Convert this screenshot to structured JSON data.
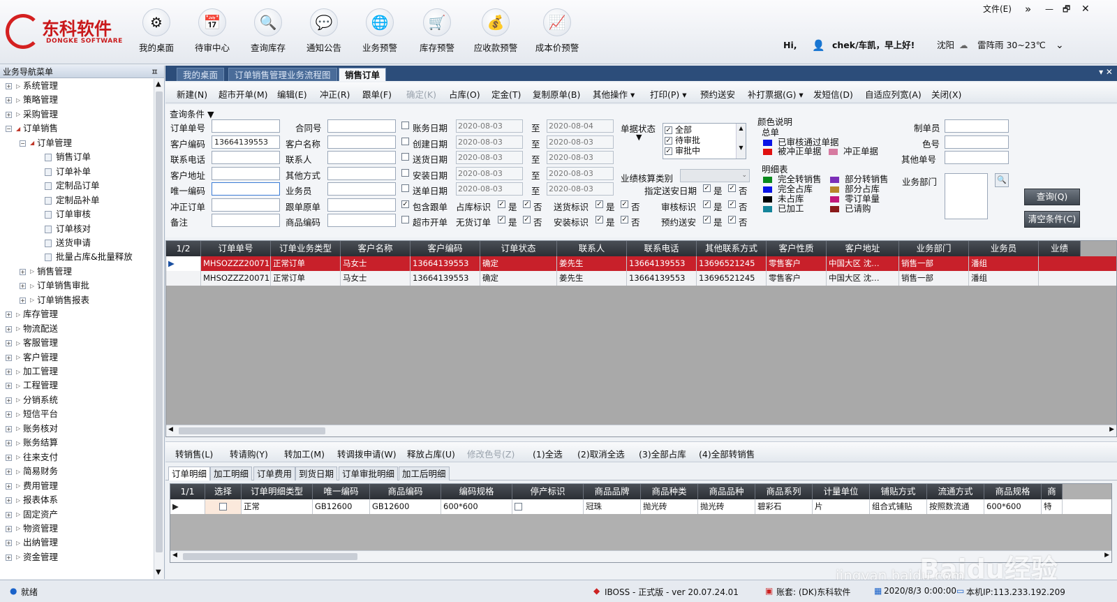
{
  "app": {
    "logo_cn": "东科软件",
    "logo_en": "DONGKE SOFTWARE"
  },
  "toolbar": [
    {
      "label": "我的桌面",
      "icon": "gear-network-icon",
      "glyph": "⚙"
    },
    {
      "label": "待审中心",
      "icon": "calendar-edit-icon",
      "glyph": "📅"
    },
    {
      "label": "查询库存",
      "icon": "magnifier-icon",
      "glyph": "🔍"
    },
    {
      "label": "通知公告",
      "icon": "chat-people-icon",
      "glyph": "💬"
    },
    {
      "label": "业务预警",
      "icon": "globe-icon",
      "glyph": "🌐"
    },
    {
      "label": "库存预警",
      "icon": "cart-window-icon",
      "glyph": "🛒"
    },
    {
      "label": "应收款预警",
      "icon": "money-person-icon",
      "glyph": "💰"
    },
    {
      "label": "成本价预警",
      "icon": "runner-arrow-icon",
      "glyph": "📈"
    }
  ],
  "window": {
    "menu": "文件(E)",
    "more": "»",
    "min": "—",
    "restore": "🗗",
    "close": "✕"
  },
  "user": {
    "hi": "Hi,",
    "greeting": "chek/车凯，早上好!",
    "city": "沈阳",
    "weather": "雷阵雨 30~23℃"
  },
  "sidebar": {
    "title": "业务导航菜单",
    "pin": "ㅍ",
    "items": [
      {
        "label": "系统管理",
        "level": 0,
        "exp": "+"
      },
      {
        "label": "策略管理",
        "level": 0,
        "exp": "+"
      },
      {
        "label": "采购管理",
        "level": 0,
        "exp": "+"
      },
      {
        "label": "订单销售",
        "level": 0,
        "exp": "-"
      },
      {
        "label": "订单管理",
        "level": 1,
        "exp": "-"
      },
      {
        "label": "销售订单",
        "level": 2
      },
      {
        "label": "订单补单",
        "level": 2
      },
      {
        "label": "定制品订单",
        "level": 2
      },
      {
        "label": "定制品补单",
        "level": 2
      },
      {
        "label": "订单审核",
        "level": 2
      },
      {
        "label": "订单核对",
        "level": 2
      },
      {
        "label": "送货申请",
        "level": 2
      },
      {
        "label": "批量占库&批量释放",
        "level": 2
      },
      {
        "label": "销售管理",
        "level": 1,
        "exp": "+"
      },
      {
        "label": "订单销售审批",
        "level": 1,
        "exp": "+"
      },
      {
        "label": "订单销售报表",
        "level": 1,
        "exp": "+"
      },
      {
        "label": "库存管理",
        "level": 0,
        "exp": "+"
      },
      {
        "label": "物流配送",
        "level": 0,
        "exp": "+"
      },
      {
        "label": "客服管理",
        "level": 0,
        "exp": "+"
      },
      {
        "label": "客户管理",
        "level": 0,
        "exp": "+"
      },
      {
        "label": "加工管理",
        "level": 0,
        "exp": "+"
      },
      {
        "label": "工程管理",
        "level": 0,
        "exp": "+"
      },
      {
        "label": "分销系统",
        "level": 0,
        "exp": "+"
      },
      {
        "label": "短信平台",
        "level": 0,
        "exp": "+"
      },
      {
        "label": "账务核对",
        "level": 0,
        "exp": "+"
      },
      {
        "label": "账务结算",
        "level": 0,
        "exp": "+"
      },
      {
        "label": "往来支付",
        "level": 0,
        "exp": "+"
      },
      {
        "label": "简易财务",
        "level": 0,
        "exp": "+"
      },
      {
        "label": "费用管理",
        "level": 0,
        "exp": "+"
      },
      {
        "label": "报表体系",
        "level": 0,
        "exp": "+"
      },
      {
        "label": "固定资产",
        "level": 0,
        "exp": "+"
      },
      {
        "label": "物资管理",
        "level": 0,
        "exp": "+"
      },
      {
        "label": "出纳管理",
        "level": 0,
        "exp": "+"
      },
      {
        "label": "资金管理",
        "level": 0,
        "exp": "+"
      }
    ]
  },
  "tabs": [
    {
      "label": "我的桌面",
      "active": false
    },
    {
      "label": "订单销售管理业务流程图",
      "active": false
    },
    {
      "label": "销售订单",
      "active": true
    }
  ],
  "tab_ctrl": "▾ ✕",
  "actions": [
    {
      "label": "新建(N)"
    },
    {
      "label": "超市开单(M)"
    },
    {
      "label": "编辑(E)"
    },
    {
      "label": "冲正(R)"
    },
    {
      "label": "跟单(F)"
    },
    {
      "label": "确定(K)",
      "disabled": true
    },
    {
      "label": "占库(O)"
    },
    {
      "label": "定金(T)"
    },
    {
      "label": "复制原单(B)"
    },
    {
      "label": "其他操作 ▾"
    },
    {
      "label": "打印(P) ▾"
    },
    {
      "label": "预约送安"
    },
    {
      "label": "补打票据(G) ▾"
    },
    {
      "label": "发短信(D)"
    },
    {
      "label": "自适应列宽(A)"
    },
    {
      "label": "关闭(X)"
    }
  ],
  "query": {
    "header": "查询条件 ▼",
    "left": [
      {
        "label": "订单单号",
        "value": ""
      },
      {
        "label": "客户编码",
        "value": "13664139553"
      },
      {
        "label": "联系电话",
        "value": ""
      },
      {
        "label": "客户地址",
        "value": ""
      },
      {
        "label": "唯一编码",
        "value": ""
      },
      {
        "label": "冲正订单",
        "value": ""
      },
      {
        "label": "备注",
        "value": ""
      }
    ],
    "mid": [
      {
        "label": "合同号",
        "value": ""
      },
      {
        "label": "客户名称",
        "value": ""
      },
      {
        "label": "联系人",
        "value": ""
      },
      {
        "label": "其他方式",
        "value": ""
      },
      {
        "label": "业务员",
        "value": ""
      },
      {
        "label": "跟单原单",
        "value": ""
      },
      {
        "label": "商品编码",
        "value": ""
      }
    ],
    "dates": [
      {
        "label": "账务日期",
        "from": "2020-08-03",
        "to": "2020-08-04"
      },
      {
        "label": "创建日期",
        "from": "2020-08-03",
        "to": "2020-08-03"
      },
      {
        "label": "送货日期",
        "from": "2020-08-03",
        "to": "2020-08-03"
      },
      {
        "label": "安装日期",
        "from": "2020-08-03",
        "to": "2020-08-03"
      },
      {
        "label": "送单日期",
        "from": "2020-08-03",
        "to": "2020-08-03"
      }
    ],
    "to": "至",
    "include_follow": "包含跟单",
    "market_open": "超市开单",
    "flags": [
      {
        "label": "占库标识"
      },
      {
        "label": "送货标识"
      },
      {
        "label": "无货订单"
      },
      {
        "label": "安装标识"
      }
    ],
    "yes": "是",
    "no": "否",
    "doc_status": {
      "label": "单据状态",
      "arrow": "▼",
      "options": [
        "全部",
        "待审批",
        "审批中"
      ]
    },
    "perf_label": "业绩核算类别",
    "flags2": [
      {
        "label": "指定送安日期"
      },
      {
        "label": "审核标识"
      },
      {
        "label": "预约送安"
      }
    ],
    "colors": {
      "title": "颜色说明",
      "summary": "总单",
      "detail": "明细表",
      "summary_items": [
        {
          "label": "已审核通过单据",
          "color": "#0a14e6"
        },
        {
          "label": "被冲正单据",
          "color": "#e01010"
        },
        {
          "label": "冲正单据",
          "color": "#d67aa0"
        }
      ],
      "detail_items": [
        {
          "label": "完全转销售",
          "color": "#0b8a1e"
        },
        {
          "label": "部分转销售",
          "color": "#7b2fb8"
        },
        {
          "label": "完全占库",
          "color": "#0a14e6"
        },
        {
          "label": "部分占库",
          "color": "#b8862a"
        },
        {
          "label": "未占库",
          "color": "#000000"
        },
        {
          "label": "零订单量",
          "color": "#c2187a"
        },
        {
          "label": "已加工",
          "color": "#14849a"
        },
        {
          "label": "已请购",
          "color": "#8a1a1a"
        }
      ]
    },
    "right": [
      {
        "label": "制单员",
        "value": ""
      },
      {
        "label": "色号",
        "value": ""
      },
      {
        "label": "其他单号",
        "value": ""
      }
    ],
    "dept_label": "业务部门",
    "search_btn": "查询(Q)",
    "clear_btn": "清空条件(C)"
  },
  "orders": {
    "page": "1/2",
    "columns": [
      "订单单号",
      "订单业务类型",
      "客户名称",
      "客户编码",
      "订单状态",
      "联系人",
      "联系电话",
      "其他联系方式",
      "客户性质",
      "客户地址",
      "业务部门",
      "业务员",
      "业绩"
    ],
    "rows": [
      [
        "MHSOZZZ20071…",
        "正常订单",
        "马女士",
        "13664139553",
        "确定",
        "姜先生",
        "13664139553",
        "13696521245",
        "零售客户",
        "中国大区 沈…",
        "销售一部",
        "潘组"
      ],
      [
        "MHSOZZZ20071…",
        "正常订单",
        "马女士",
        "13664139553",
        "确定",
        "姜先生",
        "13664139553",
        "13696521245",
        "零售客户",
        "中国大区 沈…",
        "销售一部",
        "潘组"
      ]
    ]
  },
  "sub_actions": [
    {
      "label": "转销售(L)"
    },
    {
      "label": "转请购(Y)"
    },
    {
      "label": "转加工(M)"
    },
    {
      "label": "转调拨申请(W)"
    },
    {
      "label": "释放占库(U)"
    },
    {
      "label": "修改色号(Z)",
      "disabled": true
    },
    {
      "label": "(1)全选"
    },
    {
      "label": "(2)取消全选"
    },
    {
      "label": "(3)全部占库"
    },
    {
      "label": "(4)全部转销售"
    }
  ],
  "sub_tabs": [
    "订单明细",
    "加工明细",
    "订单费用",
    "到货日期",
    "订单审批明细",
    "加工后明细"
  ],
  "details": {
    "page": "1/1",
    "columns": [
      "选择",
      "订单明细类型",
      "唯一编码",
      "商品编码",
      "编码规格",
      "停产标识",
      "商品品牌",
      "商品种类",
      "商品品种",
      "商品系列",
      "计量单位",
      "铺贴方式",
      "流通方式",
      "商品规格",
      "商"
    ],
    "rows": [
      [
        "",
        "正常",
        "GB12600",
        "GB12600",
        "600*600",
        "",
        "冠珠",
        "抛光砖",
        "抛光砖",
        "碧彩石",
        "片",
        "组合式铺贴",
        "按照数流通",
        "600*600",
        "特"
      ]
    ]
  },
  "watermark": {
    "main": "Baidu经验",
    "sub": "jingyan.baidu.com"
  },
  "status": {
    "ready": "就绪",
    "version": "IBOSS - 正式版 - ver 20.07.24.01",
    "account": "账套: (DK)东科软件",
    "datetime": "2020/8/3 0:00:00",
    "ip": "本机IP:113.233.192.209"
  }
}
